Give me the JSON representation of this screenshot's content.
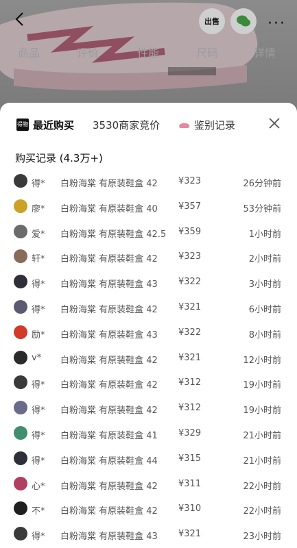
{
  "header": {
    "tabs": [
      "商品",
      "评价",
      "性能",
      "尺码",
      "详情"
    ],
    "sell_label": "出售"
  },
  "sheet": {
    "tabs": [
      {
        "label": "最近购买",
        "badge": "得物"
      },
      {
        "label": "3530商家竞价"
      },
      {
        "label": "鉴别记录"
      }
    ],
    "list_title": "购买记录 (4.3万+)"
  },
  "records": [
    {
      "user": "得*",
      "desc": "白粉海棠 有原装鞋盒 42",
      "price": "¥323",
      "time": "26分钟前",
      "avatar_color": "#3a3a3a"
    },
    {
      "user": "廖*",
      "desc": "白粉海棠 有原装鞋盒 40",
      "price": "¥357",
      "time": "53分钟前",
      "avatar_color": "#c9a227"
    },
    {
      "user": "爱*",
      "desc": "白粉海棠 有原装鞋盒 42.5",
      "price": "¥359",
      "time": "1小时前",
      "avatar_color": "#6b6b6b"
    },
    {
      "user": "轩*",
      "desc": "白粉海棠 有原装鞋盒 42",
      "price": "¥323",
      "time": "2小时前",
      "avatar_color": "#8a6a5a"
    },
    {
      "user": "得*",
      "desc": "白粉海棠 有原装鞋盒 43",
      "price": "¥322",
      "time": "3小时前",
      "avatar_color": "#2f2f3a"
    },
    {
      "user": "得*",
      "desc": "白粉海棠 有原装鞋盒 42",
      "price": "¥321",
      "time": "6小时前",
      "avatar_color": "#5a5a72"
    },
    {
      "user": "励*",
      "desc": "白粉海棠 有原装鞋盒 43",
      "price": "¥322",
      "time": "8小时前",
      "avatar_color": "#d23a2a"
    },
    {
      "user": "v*",
      "desc": "白粉海棠 有原装鞋盒 42",
      "price": "¥321",
      "time": "12小时前",
      "avatar_color": "#2a2a2a"
    },
    {
      "user": "得*",
      "desc": "白粉海棠 有原装鞋盒 42",
      "price": "¥312",
      "time": "19小时前",
      "avatar_color": "#3a3a3a"
    },
    {
      "user": "得*",
      "desc": "白粉海棠 有原装鞋盒 42",
      "price": "¥312",
      "time": "19小时前",
      "avatar_color": "#6a6a8a"
    },
    {
      "user": "得*",
      "desc": "白粉海棠 有原装鞋盒 41",
      "price": "¥329",
      "time": "21小时前",
      "avatar_color": "#3f8f6f"
    },
    {
      "user": "得*",
      "desc": "白粉海棠 有原装鞋盒 44",
      "price": "¥315",
      "time": "21小时前",
      "avatar_color": "#2f2f3a"
    },
    {
      "user": "心*",
      "desc": "白粉海棠 有原装鞋盒 42",
      "price": "¥311",
      "time": "22小时前",
      "avatar_color": "#b04060"
    },
    {
      "user": "不*",
      "desc": "白粉海棠 有原装鞋盒 42",
      "price": "¥310",
      "time": "22小时前",
      "avatar_color": "#1f1f1f"
    },
    {
      "user": "得*",
      "desc": "白粉海棠 有原装鞋盒 43",
      "price": "¥321",
      "time": "23小时前",
      "avatar_color": "#3a3a3a"
    }
  ]
}
